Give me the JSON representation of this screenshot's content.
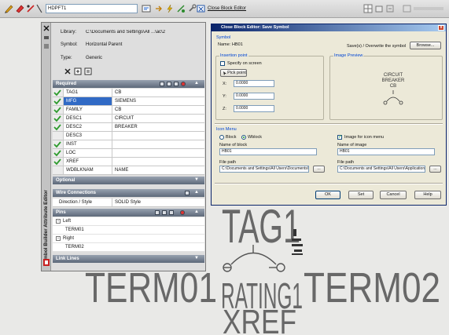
{
  "toolbar": {
    "name_field_value": "HDPFT1",
    "close_block_editor_label": "Close Block Editor"
  },
  "palette": {
    "title": "Symbol Builder Attribute Editor",
    "library_label": "Library:",
    "library_value": "C:\\Documents and Settings\\All ...\\ac\\2",
    "symbol_label": "Symbol:",
    "symbol_value": "Horizontal Parent",
    "type_label": "Type:",
    "type_value": "Generic",
    "required_header": "Required",
    "selected_row": 1,
    "required_rows": [
      {
        "name": "TAG1",
        "value": "CB",
        "checked": true
      },
      {
        "name": "MFG",
        "value": "SIEMENS",
        "checked": true
      },
      {
        "name": "FAMILY",
        "value": "CB",
        "checked": true
      },
      {
        "name": "DESC1",
        "value": "CIRCUIT",
        "checked": true
      },
      {
        "name": "DESC2",
        "value": "BREAKER",
        "checked": true
      },
      {
        "name": "DESC3",
        "value": "",
        "checked": false
      },
      {
        "name": "INST",
        "value": "",
        "checked": true
      },
      {
        "name": "LOC",
        "value": "",
        "checked": true
      },
      {
        "name": "XREF",
        "value": "",
        "checked": true
      },
      {
        "name": "WDBLKNAM",
        "value": "NAME",
        "checked": false
      }
    ],
    "optional_header": "Optional",
    "wire_header": "Wire Connections",
    "direction_label": "Direction / Style",
    "direction_value": "SOLID Style",
    "pins_header": "Pins",
    "pins_left_group": "Left",
    "pins_left_item": "TERM01",
    "pins_right_group": "Right",
    "pins_right_item": "TERM02",
    "link_lines_header": "Link Lines"
  },
  "dialog": {
    "title": "Close Block Editor: Save Symbol",
    "symbol_section": "Symbol",
    "name_label": "Name:",
    "name_value": "HB01",
    "save_hint": "Save(s) / Overwrite the symbol",
    "browse_button": "Browse...",
    "insertion_group": "Insertion point",
    "specify_on_screen": "Specify on screen",
    "specify_on_screen_checked": false,
    "pick_point_button": "Pick point",
    "x_label": "X:",
    "x_value": "0.0000",
    "y_label": "Y:",
    "y_value": "0.0000",
    "z_label": "Z:",
    "z_value": "0.0000",
    "preview_group": "Image Preview",
    "preview_line1": "CIRCUIT",
    "preview_line2": "BREAKER",
    "preview_line3": "CB",
    "icon_menu_section": "Icon Menu",
    "radio_block": "Block",
    "radio_wblock": "Wblock",
    "radio_selected": "Wblock",
    "image_for_icon_menu": "Image for icon menu",
    "image_for_icon_menu_checked": true,
    "name_of_block_label": "Name of block",
    "name_of_block_value": "HB01",
    "name_of_image_label": "Name of image",
    "name_of_image_value": "HB01",
    "file_path_label": "File path",
    "file_path_value": "C:\\Documents and Settings\\All Users\\Documents\\...",
    "image_path_label": "File path",
    "image_path_value": "C:\\Documents and Settings\\All Users\\Application Data\\...",
    "ellipsis_button": "...",
    "ok_button": "OK",
    "set_button": "Set",
    "cancel_button": "Cancel",
    "help_button": "Help"
  },
  "canvas": {
    "tag": "TAG1",
    "term_left": "TERM01",
    "rating": "RATING1",
    "term_right": "TERM02",
    "xref": "XREF"
  },
  "colors": {
    "selection": "#316ac5",
    "dialog_title": "#0a246a",
    "check": "#2e9b2e",
    "header_bar": "#5d697a"
  },
  "icons": [
    "pencil-icon",
    "erase-icon",
    "link-icon",
    "lightning-icon",
    "attribute-icon",
    "close-icon",
    "check-icon",
    "pick-point-icon"
  ]
}
